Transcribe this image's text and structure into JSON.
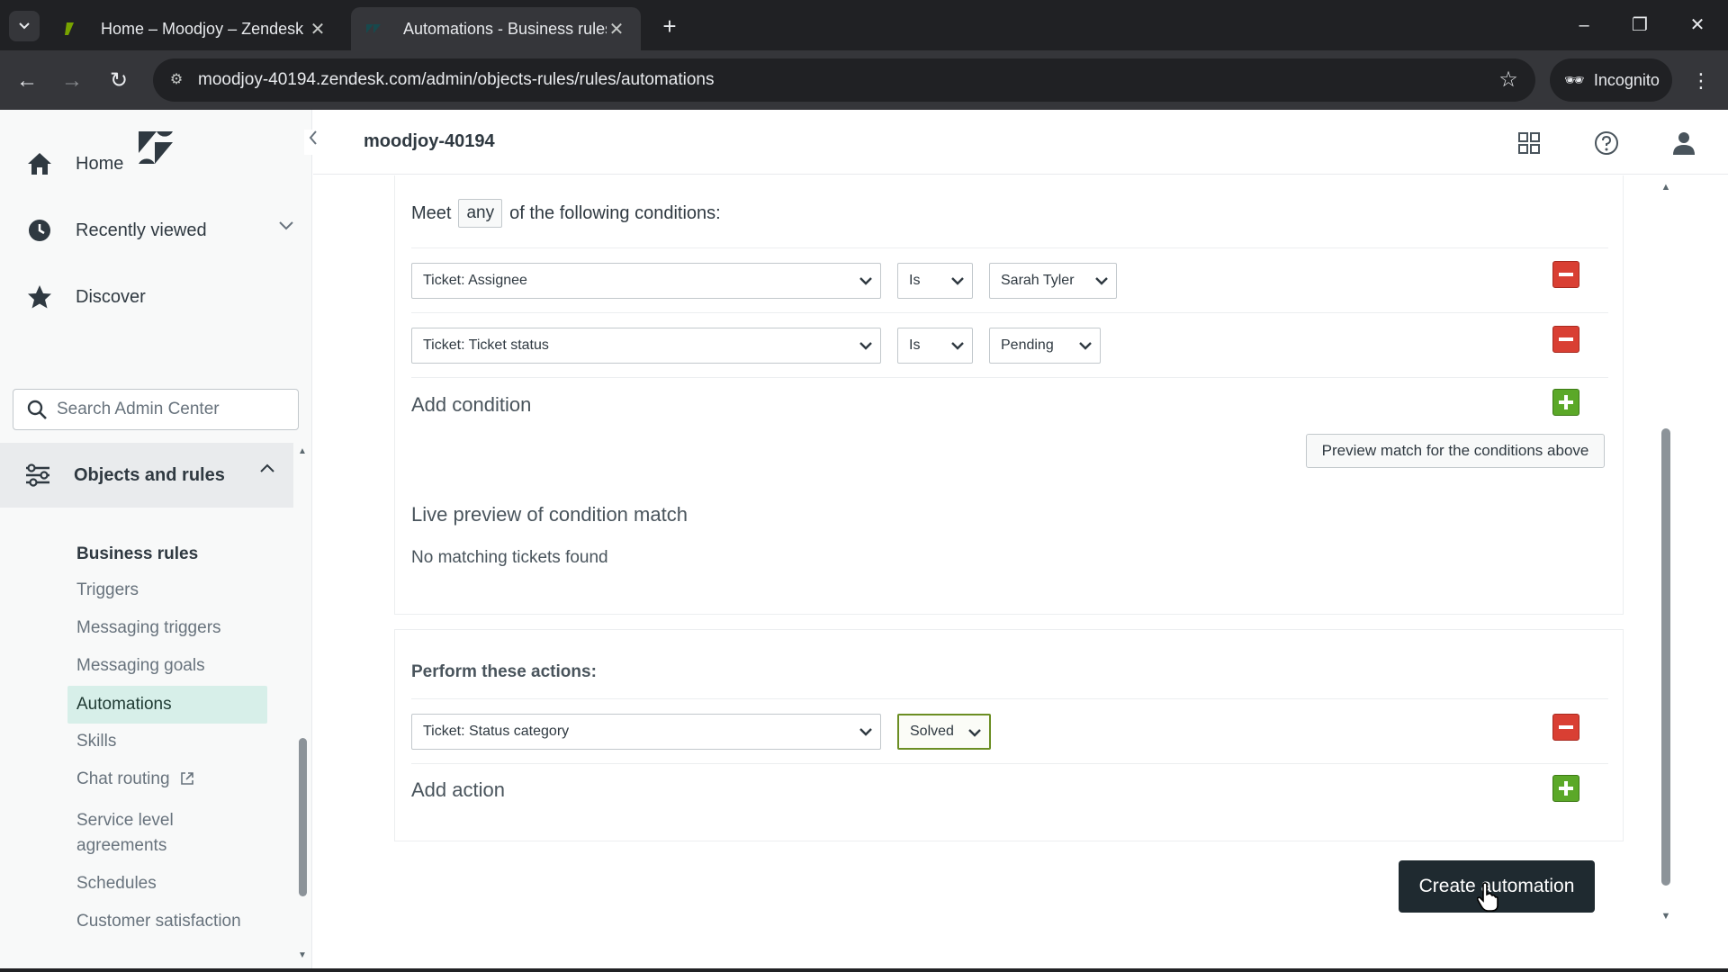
{
  "browser": {
    "tabs": [
      {
        "title": "Home – Moodjoy – Zendesk",
        "active": false
      },
      {
        "title": "Automations - Business rules -",
        "active": true
      }
    ],
    "url": "moodjoy-40194.zendesk.com/admin/objects-rules/rules/automations",
    "incognito_label": "Incognito"
  },
  "account": {
    "name": "moodjoy-40194"
  },
  "sidebar": {
    "nav": [
      {
        "label": "Home",
        "icon": "home-icon"
      },
      {
        "label": "Recently viewed",
        "icon": "clock-icon"
      },
      {
        "label": "Discover",
        "icon": "star-icon"
      }
    ],
    "search_placeholder": "Search Admin Center",
    "section_label": "Objects and rules",
    "sub_heading": "Business rules",
    "sub_items": [
      "Triggers",
      "Messaging triggers",
      "Messaging goals",
      "Automations",
      "Skills",
      "Chat routing",
      "Service level agreements",
      "Schedules",
      "Customer satisfaction"
    ],
    "active_item": "Automations"
  },
  "conditions": {
    "meet_prefix": "Meet",
    "meet_value": "any",
    "meet_suffix": "of the following conditions:",
    "rows": [
      {
        "field": "Ticket: Assignee",
        "operator": "Is",
        "value": "Sarah Tyler"
      },
      {
        "field": "Ticket: Ticket status",
        "operator": "Is",
        "value": "Pending"
      }
    ],
    "add_label": "Add condition",
    "preview_button": "Preview match for the conditions above",
    "live_preview_heading": "Live preview of condition match",
    "live_preview_result": "No matching tickets found"
  },
  "actions": {
    "heading": "Perform these actions:",
    "rows": [
      {
        "field": "Ticket: Status category",
        "value": "Solved"
      }
    ],
    "add_label": "Add action"
  },
  "create_button": "Create automation"
}
